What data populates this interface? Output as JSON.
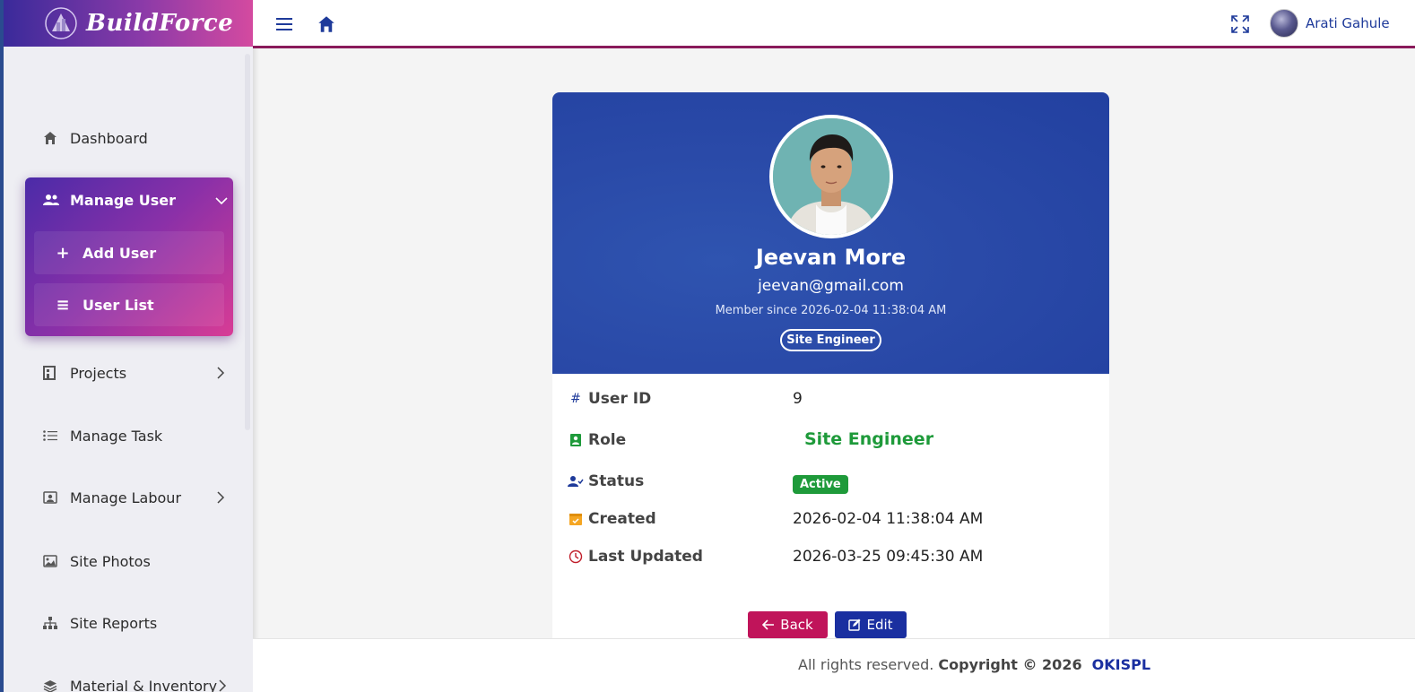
{
  "app": {
    "brand_name": "BuildForce"
  },
  "sidebar": {
    "items": [
      {
        "label": "Dashboard",
        "icon": "home-icon"
      },
      {
        "label": "Manage User",
        "icon": "users-icon",
        "expanded": true
      },
      {
        "label": "Projects",
        "icon": "building-icon"
      },
      {
        "label": "Manage Task",
        "icon": "list-icon"
      },
      {
        "label": "Manage Labour",
        "icon": "id-badge-icon"
      },
      {
        "label": "Site Photos",
        "icon": "image-icon"
      },
      {
        "label": "Site Reports",
        "icon": "sitemap-icon"
      },
      {
        "label": "Material & Inventory",
        "icon": "layers-icon"
      }
    ],
    "manage_user_sub": [
      {
        "label": "Add User",
        "icon": "plus-icon"
      },
      {
        "label": "User List",
        "icon": "list-icon"
      }
    ]
  },
  "header": {
    "user_name": "Arati Gahule"
  },
  "profile": {
    "name": "Jeevan More",
    "email": "jeevan@gmail.com",
    "member_since": "Member since 2026-02-04 11:38:04 AM",
    "role_badge": "Site Engineer"
  },
  "details": {
    "user_id_label": "User ID",
    "user_id": "9",
    "role_label": "Role",
    "role": "Site Engineer",
    "status_label": "Status",
    "status": "Active",
    "created_label": "Created",
    "created": "2026-02-04 11:38:04 AM",
    "updated_label": "Last Updated",
    "updated": "2026-03-25 09:45:30 AM"
  },
  "actions": {
    "back_label": "Back",
    "edit_label": "Edit"
  },
  "footer": {
    "rights": "All rights reserved.",
    "copyright": "Copyright © 2026",
    "company": "OKISPL"
  },
  "colors": {
    "accent_blue": "#2a4aa8",
    "success": "#1e9a3a",
    "back_button": "#c0145a",
    "edit_button": "#1a2fa0",
    "sidebar_gradient_start": "#4b2ba8",
    "sidebar_gradient_end": "#d83c95"
  }
}
